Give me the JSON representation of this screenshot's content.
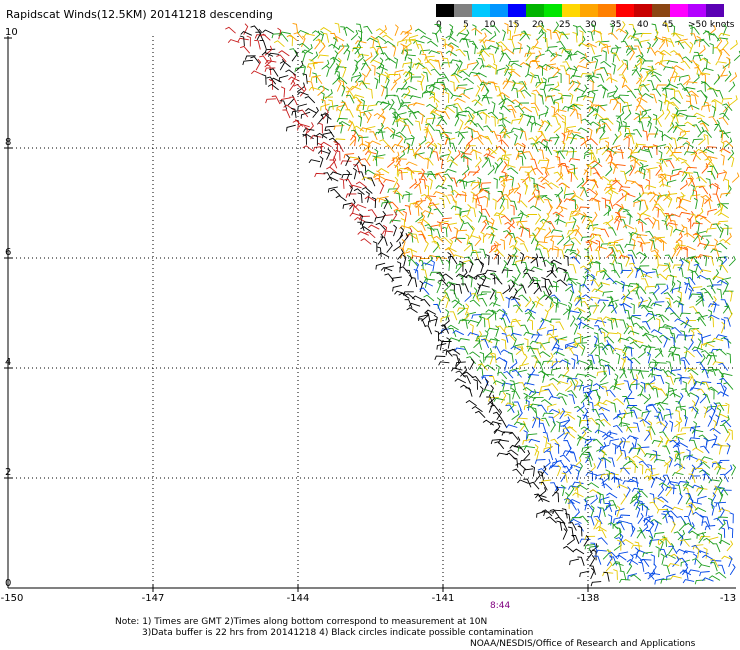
{
  "title": "Rapidscat Winds(12.5KM) 20141218 descending",
  "legend": {
    "labels": [
      "0",
      "5",
      "10",
      "15",
      "20",
      "25",
      "30",
      "35",
      "40",
      "45",
      ">50 knots"
    ],
    "colors": [
      "#000000",
      "#808080",
      "#00c8ff",
      "#0096ff",
      "#0000ff",
      "#00b400",
      "#00e600",
      "#ffd700",
      "#ffa500",
      "#ff7f00",
      "#ff0000",
      "#c80000",
      "#8b4513",
      "#ff00ff",
      "#b400ff",
      "#5a00b4"
    ]
  },
  "axes": {
    "y_labels": [
      "10",
      "8",
      "6",
      "4",
      "2",
      "0"
    ],
    "x_labels": [
      "-150",
      "-147",
      "-144",
      "-141",
      "-138",
      "-13"
    ]
  },
  "time_label": "8:44",
  "notes": {
    "line1": "Note: 1) Times are GMT 2)Times along bottom correspond to measurement at 10N",
    "line2": "3)Data buffer is 22 hrs from 20141218 4) Black circles indicate possible contamination",
    "line3": "NOAA/NESDIS/Office of Research and Applications"
  }
}
